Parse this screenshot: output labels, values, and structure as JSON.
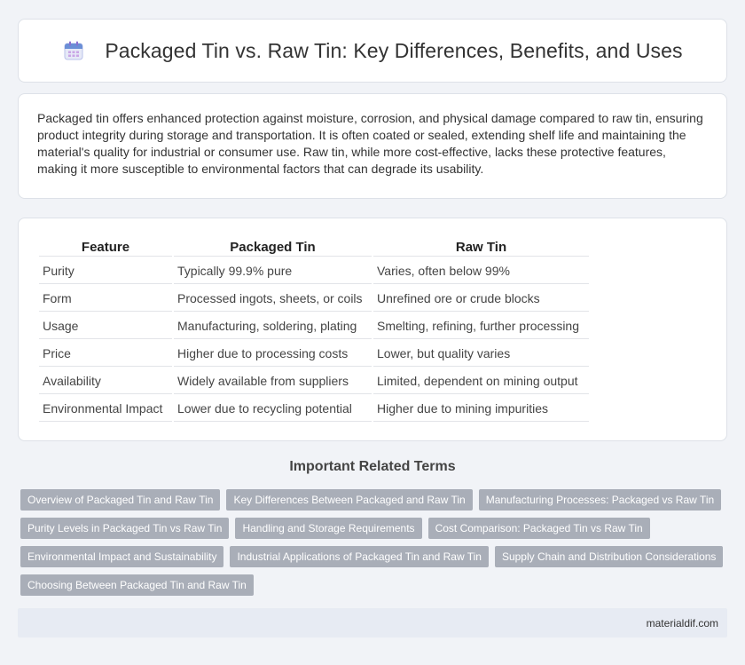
{
  "header": {
    "icon": "calendar-icon",
    "title": "Packaged Tin vs. Raw Tin: Key Differences, Benefits, and Uses"
  },
  "intro": {
    "text": "Packaged tin offers enhanced protection against moisture, corrosion, and physical damage compared to raw tin, ensuring product integrity during storage and transportation. It is often coated or sealed, extending shelf life and maintaining the material's quality for industrial or consumer use. Raw tin, while more cost-effective, lacks these protective features, making it more susceptible to environmental factors that can degrade its usability."
  },
  "table": {
    "headers": [
      "Feature",
      "Packaged Tin",
      "Raw Tin"
    ],
    "rows": [
      [
        "Purity",
        "Typically 99.9% pure",
        "Varies, often below 99%"
      ],
      [
        "Form",
        "Processed ingots, sheets, or coils",
        "Unrefined ore or crude blocks"
      ],
      [
        "Usage",
        "Manufacturing, soldering, plating",
        "Smelting, refining, further processing"
      ],
      [
        "Price",
        "Higher due to processing costs",
        "Lower, but quality varies"
      ],
      [
        "Availability",
        "Widely available from suppliers",
        "Limited, dependent on mining output"
      ],
      [
        "Environmental Impact",
        "Lower due to recycling potential",
        "Higher due to mining impurities"
      ]
    ]
  },
  "related": {
    "title": "Important Related Terms",
    "tags": [
      "Overview of Packaged Tin and Raw Tin",
      "Key Differences Between Packaged and Raw Tin",
      "Manufacturing Processes: Packaged vs Raw Tin",
      "Purity Levels in Packaged Tin vs Raw Tin",
      "Handling and Storage Requirements",
      "Cost Comparison: Packaged Tin vs Raw Tin",
      "Environmental Impact and Sustainability",
      "Industrial Applications of Packaged Tin and Raw Tin",
      "Supply Chain and Distribution Considerations",
      "Choosing Between Packaged Tin and Raw Tin"
    ]
  },
  "footer": {
    "site": "materialdif.com"
  },
  "colors": {
    "background": "#f1f3f7",
    "tag": "#a9aeb8",
    "footer": "#e7ebf3",
    "icon_accent": "#6b8fd6"
  }
}
